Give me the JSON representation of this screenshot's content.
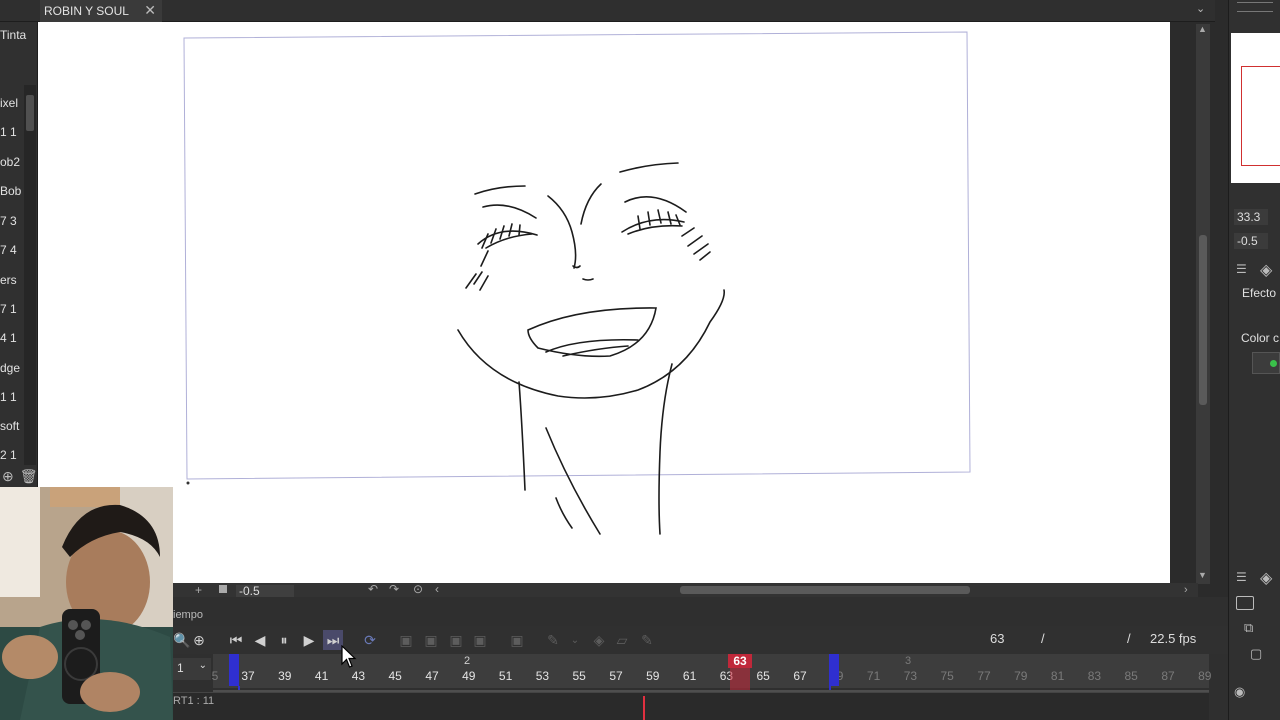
{
  "document_tab": {
    "title": "ROBIN Y SOUL",
    "close": "✕"
  },
  "left_panel": {
    "items": [
      "Tinta",
      "ixel",
      "1 1",
      "ob2",
      "Bob",
      "7 3",
      "7 4",
      "ers",
      "7 1",
      "4 1",
      "dge",
      "1 1",
      "soft",
      "2 1"
    ]
  },
  "canvas_status": {
    "zoom_value": "-0.5"
  },
  "right_panel": {
    "field1": "33.3",
    "field2": "-0.5",
    "label_effects": "Efecto",
    "label_color": "Color c"
  },
  "timeline": {
    "panel_tab": "iempo",
    "current_frame": "63",
    "slash": "/",
    "fps": "22.5 fps",
    "layer_select": "1",
    "track_label": "RT1 : 11",
    "playhead": "63",
    "ruler_ticks": [
      "37",
      "39",
      "41",
      "43",
      "45",
      "47",
      "49",
      "51",
      "53",
      "55",
      "57",
      "59",
      "61",
      "63",
      "65",
      "67",
      "69",
      "71",
      "73",
      "75",
      "77",
      "79",
      "81",
      "83",
      "85",
      "87",
      "89"
    ],
    "section_labels": [
      "2",
      "3"
    ],
    "left_cut_tick": "5"
  },
  "colors": {
    "accent_red": "#c0283a",
    "marker_blue": "#2f2fd0",
    "canvas_bg": "#ffffff"
  }
}
